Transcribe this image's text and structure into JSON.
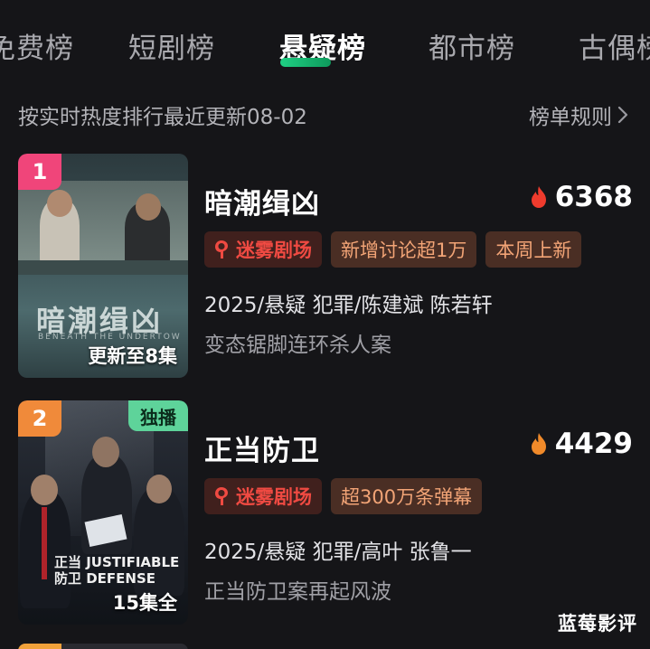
{
  "tabs": [
    {
      "label": "免费榜",
      "active": false
    },
    {
      "label": "短剧榜",
      "active": false
    },
    {
      "label": "悬疑榜",
      "active": true
    },
    {
      "label": "都市榜",
      "active": false
    },
    {
      "label": "古偶榜",
      "active": false
    }
  ],
  "subbar": {
    "update_text": "按实时热度排行最近更新08-02",
    "rules_label": "榜单规则"
  },
  "items": [
    {
      "rank": "1",
      "title": "暗潮缉凶",
      "heat": "6368",
      "poster_title": "暗潮缉凶",
      "poster_subtitle": "BENEATH THE UNDERTOW",
      "episode_status": "更新至8集",
      "tags": [
        "迷雾剧场",
        "新增讨论超1万",
        "本周上新"
      ],
      "meta": "2025/悬疑 犯罪/陈建斌 陈若轩",
      "description": "变态锯脚连环杀人案"
    },
    {
      "rank": "2",
      "exclusive_badge": "独播",
      "title": "正当防卫",
      "heat": "4429",
      "poster_title_line1": "正当 JUSTIFIABLE",
      "poster_title_line2": "防卫 DEFENSE",
      "episode_status": "15集全",
      "tags": [
        "迷雾剧场",
        "超300万条弹幕"
      ],
      "meta": "2025/悬疑 犯罪/高叶 张鲁一",
      "description": "正当防卫案再起风波"
    }
  ],
  "watermark": "蓝莓影评",
  "colors": {
    "background": "#151518",
    "active_underline": "#1fcf83",
    "rank1": "#f0457a",
    "rank2": "#f08a3a",
    "brand_tag": "#ef4a42",
    "info_tag": "#f2a476",
    "exclusive": "#5ed39a"
  },
  "icons": {
    "heat": "flame-icon",
    "rules": "chevron-right-icon",
    "brand": "mist-theater-logo-icon"
  }
}
